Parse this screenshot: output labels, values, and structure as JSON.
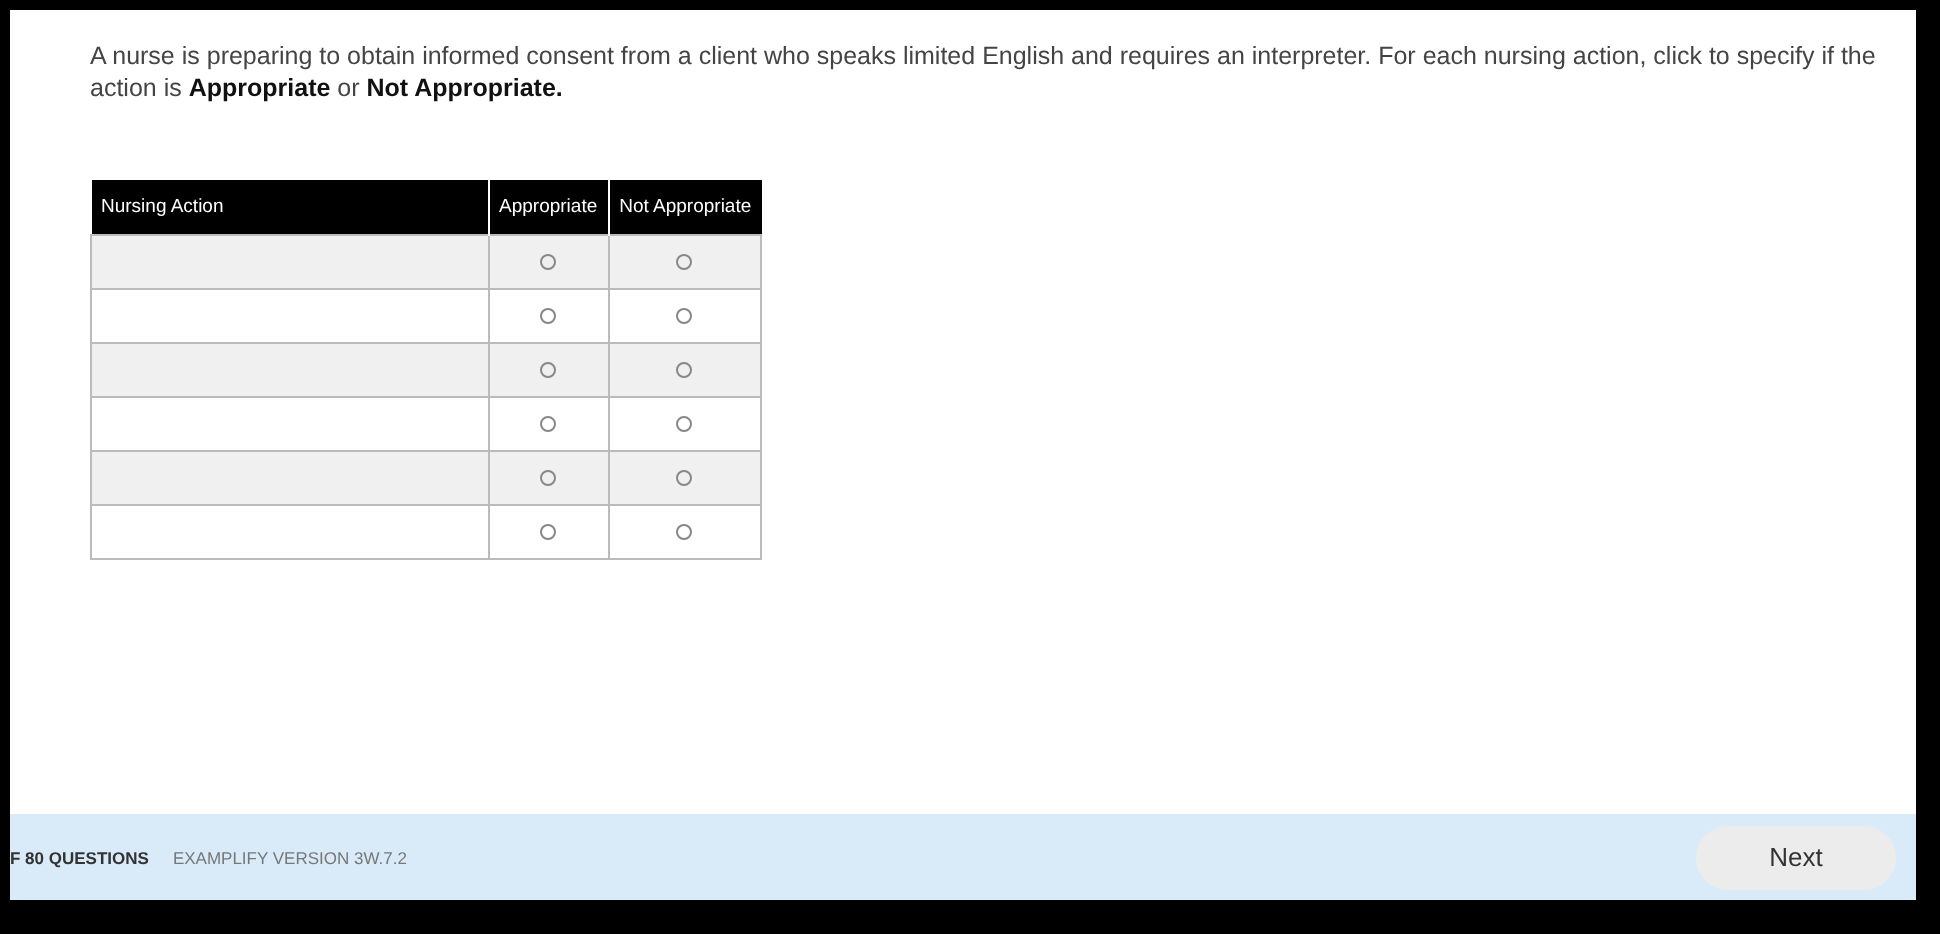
{
  "question": {
    "prompt": "A nurse is preparing to obtain informed consent from a client who speaks limited English and requires an interpreter. For each nursing action, click to specify if the action is **Appropriate** or **Not Appropriate.**"
  },
  "table": {
    "columns": [
      "Nursing Action",
      "Appropriate",
      "Not Appropriate"
    ],
    "rows": [
      {
        "options": [
          {
            "selected": false
          },
          {
            "selected": false
          }
        ]
      },
      {
        "options": [
          {
            "selected": false
          },
          {
            "selected": false
          }
        ]
      },
      {
        "options": [
          {
            "selected": false
          },
          {
            "selected": false
          }
        ]
      },
      {
        "options": [
          {
            "selected": false
          },
          {
            "selected": false
          }
        ]
      },
      {
        "options": [
          {
            "selected": false
          },
          {
            "selected": false
          }
        ]
      },
      {
        "options": [
          {
            "selected": false
          },
          {
            "selected": false
          }
        ]
      }
    ]
  },
  "footer": {
    "progress": "F 80 QUESTIONS",
    "version": "EXAMPLIFY VERSION 3W.7.2",
    "next_button": "Next"
  }
}
